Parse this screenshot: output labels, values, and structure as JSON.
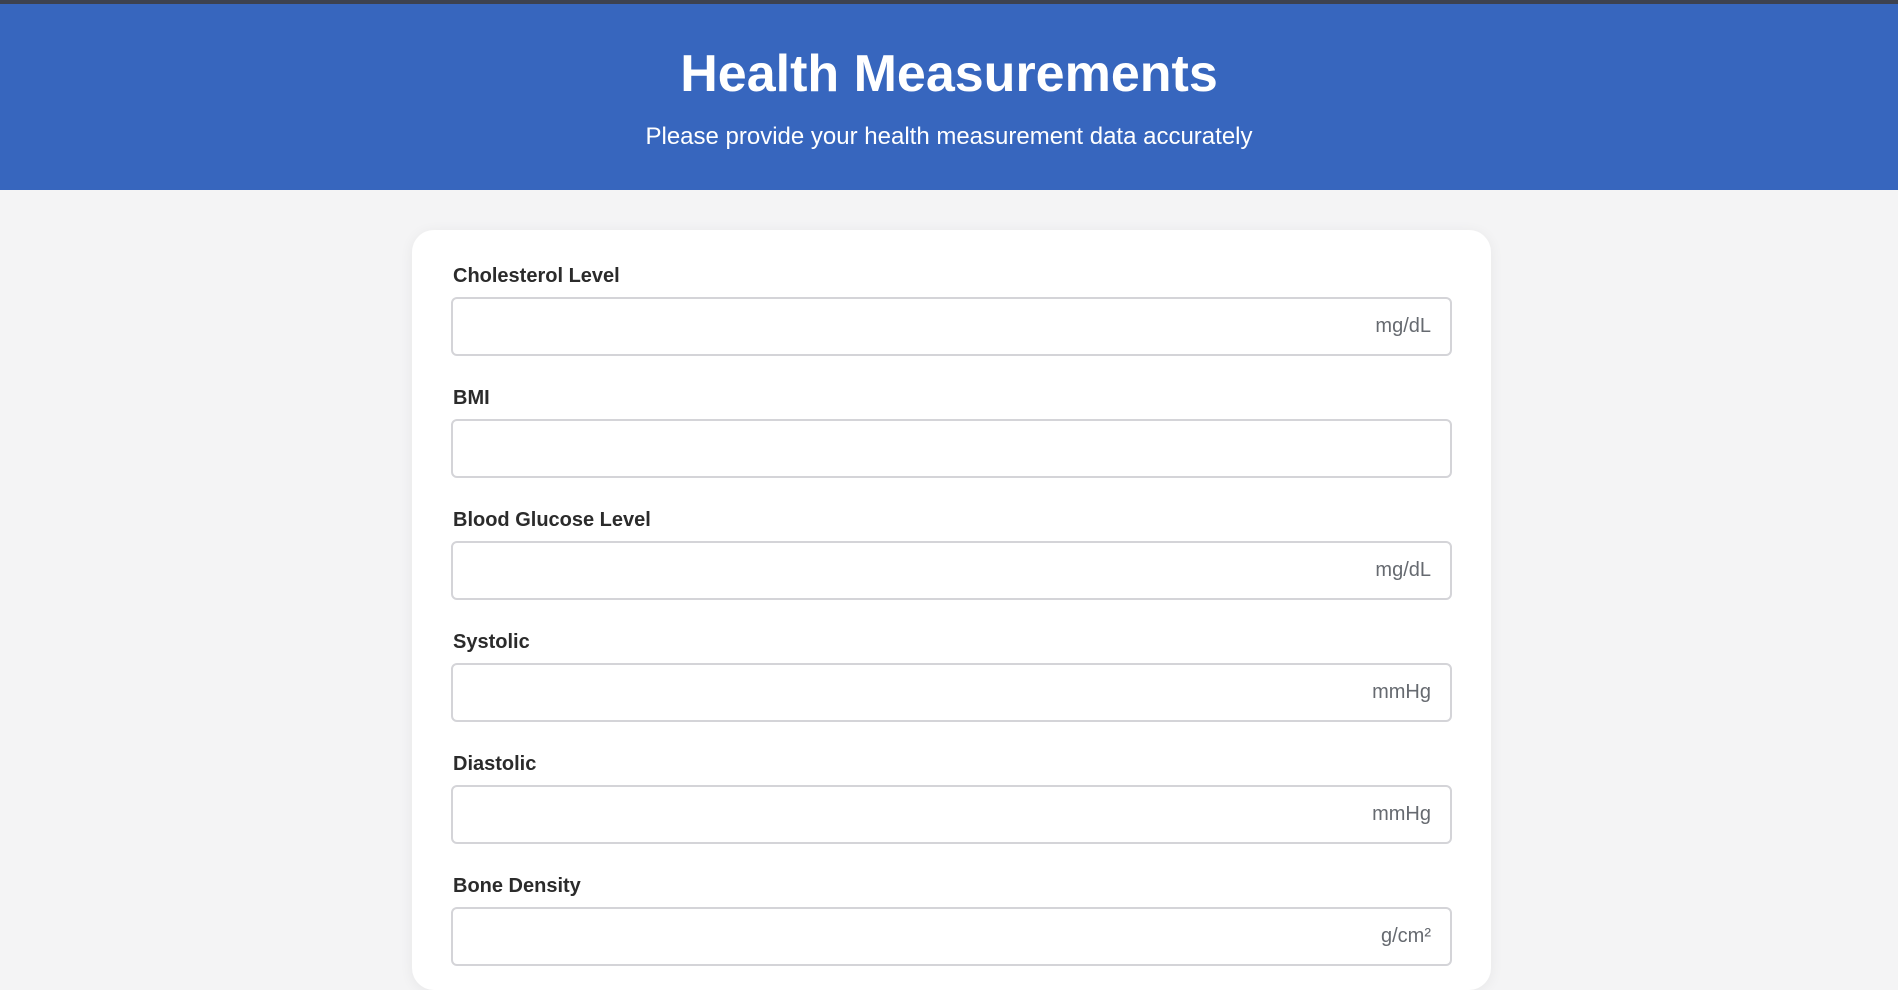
{
  "header": {
    "title": "Health Measurements",
    "subtitle": "Please provide your health measurement data accurately",
    "background_color": "#3766be"
  },
  "form": {
    "fields": [
      {
        "label": "Cholesterol Level",
        "value": "",
        "unit": "mg/dL"
      },
      {
        "label": "BMI",
        "value": "",
        "unit": ""
      },
      {
        "label": "Blood Glucose Level",
        "value": "",
        "unit": "mg/dL"
      },
      {
        "label": "Systolic",
        "value": "",
        "unit": "mmHg"
      },
      {
        "label": "Diastolic",
        "value": "",
        "unit": "mmHg"
      },
      {
        "label": "Bone Density",
        "value": "",
        "unit": "g/cm²"
      }
    ]
  }
}
